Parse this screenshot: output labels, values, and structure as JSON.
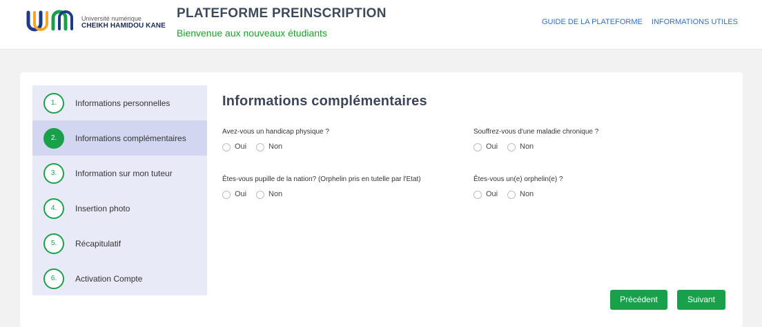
{
  "header": {
    "logo": {
      "line1": "Université numérique",
      "line2": "CHEIKH HAMIDOU KANE",
      "colors": [
        "#1e3a8a",
        "#f5a623",
        "#1aa04b"
      ]
    },
    "title": "PLATEFORME PREINSCRIPTION",
    "subtitle": "Bienvenue aux nouveaux étudiants",
    "nav": [
      "GUIDE DE LA PLATEFORME",
      "INFORMATIONS UTILES"
    ]
  },
  "stepper": {
    "active_step": 2,
    "accent_color": "#1aa04b",
    "steps": [
      {
        "number": "1.",
        "label": "Informations personnelles"
      },
      {
        "number": "2.",
        "label": "Informations complémentaires"
      },
      {
        "number": "3.",
        "label": "Information sur mon tuteur"
      },
      {
        "number": "4.",
        "label": "Insertion photo"
      },
      {
        "number": "5.",
        "label": "Récapitulatif"
      },
      {
        "number": "6.",
        "label": "Activation Compte"
      }
    ]
  },
  "form": {
    "title": "Informations complémentaires",
    "questions": [
      {
        "label": "Avez-vous un handicap physique ?",
        "options": [
          "Oui",
          "Non"
        ]
      },
      {
        "label": "Souffrez-vous d'une maladie chronique ?",
        "options": [
          "Oui",
          "Non"
        ]
      },
      {
        "label": "Êtes-vous pupille de la nation? (Orphelin pris en tutelle par l'Etat)",
        "options": [
          "Oui",
          "Non"
        ]
      },
      {
        "label": "Êtes-vous un(e) orphelin(e) ?",
        "options": [
          "Oui",
          "Non"
        ]
      }
    ],
    "buttons": {
      "previous": "Précédent",
      "next": "Suivant"
    }
  }
}
